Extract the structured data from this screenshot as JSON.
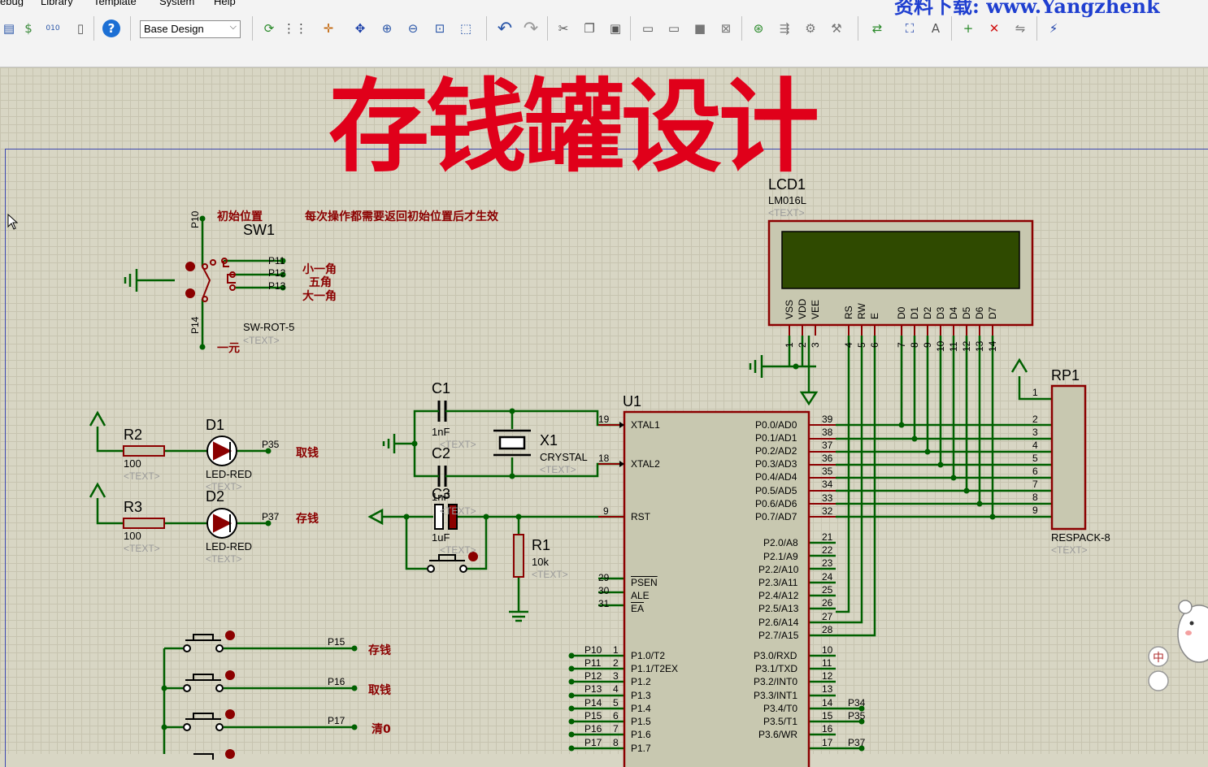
{
  "menu": [
    "ebug",
    "Library",
    "Template",
    "System",
    "Help"
  ],
  "toolbar": {
    "design_select": "Base Design",
    "watermark": "资料下载: www.Yangzhenk"
  },
  "title": "存钱罐设计",
  "sw1": {
    "ref": "SW1",
    "value": "SW-ROT-5",
    "text": "<TEXT>",
    "pins": [
      "P10",
      "P11",
      "P12",
      "P13",
      "P14"
    ],
    "labels": {
      "init": "初始位置",
      "note": "每次操作都需要返回初始位置后才生效",
      "p11": "小一角",
      "p12": "五角",
      "p13": "大一角",
      "p14": "一元"
    }
  },
  "lcd": {
    "ref": "LCD1",
    "value": "LM016L",
    "text": "<TEXT>",
    "pins": [
      "VSS",
      "VDD",
      "VEE",
      "RS",
      "RW",
      "E",
      "D0",
      "D1",
      "D2",
      "D3",
      "D4",
      "D5",
      "D6",
      "D7"
    ],
    "nums": [
      "1",
      "2",
      "3",
      "4",
      "5",
      "6",
      "7",
      "8",
      "9",
      "10",
      "11",
      "12",
      "13",
      "14"
    ]
  },
  "rp1": {
    "ref": "RP1",
    "value": "RESPACK-8",
    "text": "<TEXT>",
    "nums": [
      "1",
      "2",
      "3",
      "4",
      "5",
      "6",
      "7",
      "8",
      "9"
    ]
  },
  "r2": {
    "ref": "R2",
    "value": "100",
    "text": "<TEXT>"
  },
  "r3": {
    "ref": "R3",
    "value": "100",
    "text": "<TEXT>"
  },
  "d1": {
    "ref": "D1",
    "value": "LED-RED",
    "text": "<TEXT>",
    "net": "P35",
    "label": "取钱"
  },
  "d2": {
    "ref": "D2",
    "value": "LED-RED",
    "text": "<TEXT>",
    "net": "P37",
    "label": "存钱"
  },
  "c1": {
    "ref": "C1",
    "value": "1nF",
    "text": "<TEXT>"
  },
  "c2": {
    "ref": "C2",
    "value": "1nF",
    "text": "<TEXT>"
  },
  "c3": {
    "ref": "C3",
    "value": "1uF",
    "text": "<TEXT>"
  },
  "x1": {
    "ref": "X1",
    "value": "CRYSTAL",
    "text": "<TEXT>"
  },
  "r1": {
    "ref": "R1",
    "value": "10k",
    "text": "<TEXT>"
  },
  "u1": {
    "ref": "U1",
    "left_pins": [
      {
        "n": "19",
        "l": "XTAL1"
      },
      {
        "n": "18",
        "l": "XTAL2"
      },
      {
        "n": "9",
        "l": "RST"
      },
      {
        "n": "29",
        "l": "PSEN"
      },
      {
        "n": "30",
        "l": "ALE"
      },
      {
        "n": "31",
        "l": "EA"
      }
    ],
    "p0": [
      {
        "n": "39",
        "l": "P0.0/AD0"
      },
      {
        "n": "38",
        "l": "P0.1/AD1"
      },
      {
        "n": "37",
        "l": "P0.2/AD2"
      },
      {
        "n": "36",
        "l": "P0.3/AD3"
      },
      {
        "n": "35",
        "l": "P0.4/AD4"
      },
      {
        "n": "34",
        "l": "P0.5/AD5"
      },
      {
        "n": "33",
        "l": "P0.6/AD6"
      },
      {
        "n": "32",
        "l": "P0.7/AD7"
      }
    ],
    "p2": [
      {
        "n": "21",
        "l": "P2.0/A8"
      },
      {
        "n": "22",
        "l": "P2.1/A9"
      },
      {
        "n": "23",
        "l": "P2.2/A10"
      },
      {
        "n": "24",
        "l": "P2.3/A11"
      },
      {
        "n": "25",
        "l": "P2.4/A12"
      },
      {
        "n": "26",
        "l": "P2.5/A13"
      },
      {
        "n": "27",
        "l": "P2.6/A14"
      },
      {
        "n": "28",
        "l": "P2.7/A15"
      }
    ],
    "p3": [
      {
        "n": "10",
        "l": "P3.0/RXD"
      },
      {
        "n": "11",
        "l": "P3.1/TXD"
      },
      {
        "n": "12",
        "l": "P3.2/INT0"
      },
      {
        "n": "13",
        "l": "P3.3/INT1"
      },
      {
        "n": "14",
        "l": "P3.4/T0"
      },
      {
        "n": "15",
        "l": "P3.5/T1"
      },
      {
        "n": "16",
        "l": "P3.6/WR"
      },
      {
        "n": "17",
        "l": "P3.7/RD"
      }
    ],
    "p1": [
      {
        "net": "P10",
        "n": "1",
        "l": "P1.0/T2"
      },
      {
        "net": "P11",
        "n": "2",
        "l": "P1.1/T2EX"
      },
      {
        "net": "P12",
        "n": "3",
        "l": "P1.2"
      },
      {
        "net": "P13",
        "n": "4",
        "l": "P1.3"
      },
      {
        "net": "P14",
        "n": "5",
        "l": "P1.4"
      },
      {
        "net": "P15",
        "n": "6",
        "l": "P1.5"
      },
      {
        "net": "P16",
        "n": "7",
        "l": "P1.6"
      },
      {
        "net": "P17",
        "n": "8",
        "l": "P1.7"
      }
    ],
    "p3nets": [
      "P34",
      "P35",
      "P37"
    ]
  },
  "buttons": [
    {
      "net": "P15",
      "label": "存钱"
    },
    {
      "net": "P16",
      "label": "取钱"
    },
    {
      "net": "P17",
      "label": "清0"
    }
  ],
  "ime": {
    "lang": "中"
  },
  "colors": {
    "wire": "#006000",
    "body": "#8b0000",
    "fill": "#c8c8b0",
    "title": "#e0001a"
  }
}
